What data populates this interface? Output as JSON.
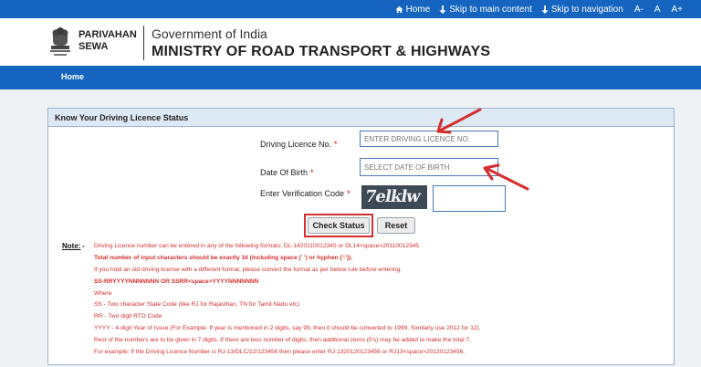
{
  "topbar": {
    "home": "Home",
    "skip_main": "Skip to main content",
    "skip_nav": "Skip to navigation",
    "font_sizes": [
      "A-",
      "A",
      "A+"
    ]
  },
  "header": {
    "brand_line1": "PARIVAHAN",
    "brand_line2": "SEWA",
    "gov": "Government of India",
    "ministry": "MINISTRY OF ROAD TRANSPORT & HIGHWAYS"
  },
  "nav": {
    "home": "Home"
  },
  "form": {
    "title": "Know Your Driving Licence Status",
    "dl_label": "Driving Licence No.",
    "dl_placeholder": "ENTER DRIVING LICENCE NO.",
    "dob_label": "Date Of Birth",
    "dob_placeholder": "SELECT DATE OF BIRTH",
    "code_label": "Enter Verification Code",
    "required_mark": "*",
    "captcha_text": "7elklw",
    "check_label": "Check Status",
    "reset_label": "Reset"
  },
  "notes": {
    "label": "Note:",
    "dash": "-",
    "lines": [
      "Driving Licence number can be entered in any of the following formats: DL-1420110012345 or DL14<space>20110012345",
      "Total number of input characters should be exactly 16 (including space (' ') or hyphen ('-')).",
      "If you hold an old driving license with a different format, please convert the format as per below rule before entering.",
      "SS-RRYYYYNNNNNNN OR SSRR<space>YYYYNNNNNNN",
      "Where",
      "SS - Two character State Code (like RJ for Rajasthan, TN for Tamil Nadu etc)",
      "RR - Two digit RTO Code",
      "YYYY - 4-digit Year of Issue (For Example: If year is mentioned in 2 digits, say 99, then it should be converted to 1999. Similarly use 2012 for 12).",
      "Rest of the numbers are to be given in 7 digits. If there are less number of digits, then additional zeros (0's) may be added to make the total 7.",
      "For example: If the Driving Licence Number is RJ-13/DLC/12/123456 then please enter RJ-1320120123456 or RJ13<space>20120123456."
    ]
  },
  "colors": {
    "primary": "#1565c0",
    "accent_red": "#d32f2f"
  }
}
